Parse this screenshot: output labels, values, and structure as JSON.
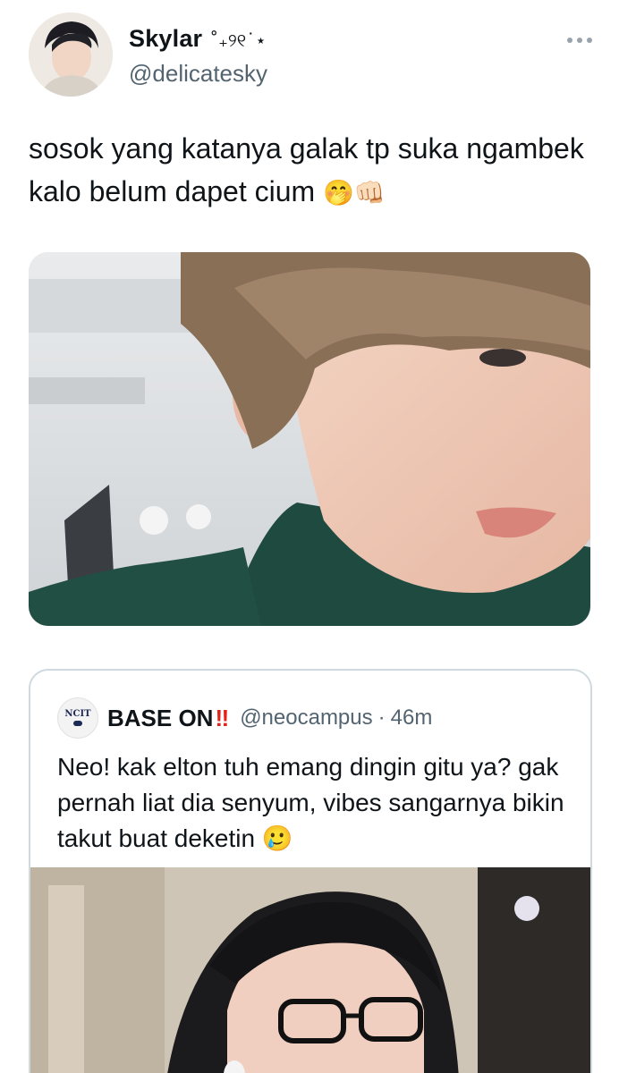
{
  "author": {
    "display_name": "Skylar",
    "name_decoration": "˚₊୨୧˙⋆",
    "handle": "@delicatesky",
    "avatar_icon": "profile-photo"
  },
  "tweet": {
    "text": "sosok yang katanya galak tp suka ngambek kalo belum dapet cium",
    "emojis": "🤭👊🏻",
    "more_icon": "more-horizontal-icon"
  },
  "quoted_tweet": {
    "display_name": "BASE ON",
    "name_suffix": "‼",
    "handle": "@neocampus",
    "separator": "·",
    "time": "46m",
    "avatar_text": "NCIT",
    "text": "Neo! kak elton tuh emang dingin gitu ya? gak pernah liat dia senyum, vibes sangarnya bikin takut buat deketin",
    "emoji": "🥲"
  },
  "colors": {
    "secondary_text": "#536471",
    "border": "#cfd9de",
    "alert_red": "#e0241b"
  }
}
